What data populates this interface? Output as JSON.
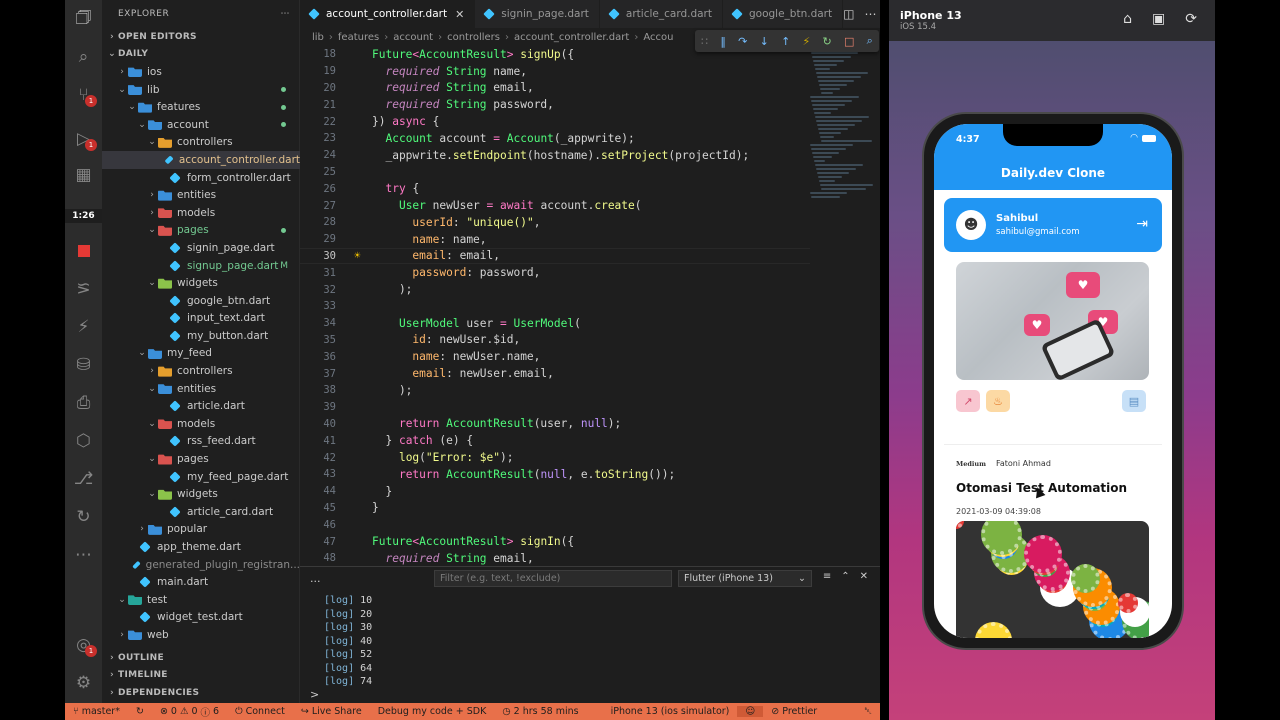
{
  "explorer": {
    "title": "EXPLORER",
    "sections": {
      "open_editors": "OPEN EDITORS",
      "project": "DAILY",
      "outline": "OUTLINE",
      "timeline": "TIMELINE",
      "dependencies": "DEPENDENCIES"
    },
    "tree": [
      {
        "label": "ios",
        "type": "folder",
        "depth": 1,
        "open": false
      },
      {
        "label": "lib",
        "type": "folder",
        "depth": 1,
        "open": true,
        "dot": true
      },
      {
        "label": "features",
        "type": "folder",
        "depth": 2,
        "open": true,
        "dot": true
      },
      {
        "label": "account",
        "type": "folder",
        "depth": 3,
        "open": true,
        "dot": true
      },
      {
        "label": "controllers",
        "type": "folder-orange",
        "depth": 4,
        "open": true
      },
      {
        "label": "account_controller.dart",
        "type": "dart",
        "depth": 5,
        "selected": true,
        "style": "orange"
      },
      {
        "label": "form_controller.dart",
        "type": "dart",
        "depth": 5
      },
      {
        "label": "entities",
        "type": "folder",
        "depth": 4,
        "open": false
      },
      {
        "label": "models",
        "type": "folder-red",
        "depth": 4,
        "open": false
      },
      {
        "label": "pages",
        "type": "folder-red",
        "depth": 4,
        "open": true,
        "style": "green",
        "dot": true
      },
      {
        "label": "signin_page.dart",
        "type": "dart",
        "depth": 5
      },
      {
        "label": "signup_page.dart",
        "type": "dart",
        "depth": 5,
        "style": "green",
        "mark": "M"
      },
      {
        "label": "widgets",
        "type": "folder-green",
        "depth": 4,
        "open": true
      },
      {
        "label": "google_btn.dart",
        "type": "dart",
        "depth": 5
      },
      {
        "label": "input_text.dart",
        "type": "dart",
        "depth": 5
      },
      {
        "label": "my_button.dart",
        "type": "dart",
        "depth": 5
      },
      {
        "label": "my_feed",
        "type": "folder",
        "depth": 3,
        "open": true
      },
      {
        "label": "controllers",
        "type": "folder-orange",
        "depth": 4,
        "open": false
      },
      {
        "label": "entities",
        "type": "folder",
        "depth": 4,
        "open": true
      },
      {
        "label": "article.dart",
        "type": "dart",
        "depth": 5
      },
      {
        "label": "models",
        "type": "folder-red",
        "depth": 4,
        "open": true
      },
      {
        "label": "rss_feed.dart",
        "type": "dart",
        "depth": 5
      },
      {
        "label": "pages",
        "type": "folder-red",
        "depth": 4,
        "open": true
      },
      {
        "label": "my_feed_page.dart",
        "type": "dart",
        "depth": 5
      },
      {
        "label": "widgets",
        "type": "folder-green",
        "depth": 4,
        "open": true
      },
      {
        "label": "article_card.dart",
        "type": "dart",
        "depth": 5
      },
      {
        "label": "popular",
        "type": "folder",
        "depth": 3,
        "open": false
      },
      {
        "label": "app_theme.dart",
        "type": "dart",
        "depth": 2
      },
      {
        "label": "generated_plugin_registran...",
        "type": "dart",
        "depth": 2,
        "style": "muted"
      },
      {
        "label": "main.dart",
        "type": "dart",
        "depth": 2
      },
      {
        "label": "test",
        "type": "folder-teal",
        "depth": 1,
        "open": true
      },
      {
        "label": "widget_test.dart",
        "type": "dart",
        "depth": 2
      },
      {
        "label": "web",
        "type": "folder",
        "depth": 1,
        "open": false
      }
    ]
  },
  "activity": {
    "timer": "1:26",
    "badge_count": "1"
  },
  "tabs": [
    {
      "label": "account_controller.dart",
      "active": true
    },
    {
      "label": "signin_page.dart"
    },
    {
      "label": "article_card.dart"
    },
    {
      "label": "google_btn.dart"
    }
  ],
  "breadcrumb": [
    "lib",
    "features",
    "account",
    "controllers",
    "account_controller.dart",
    "Accou"
  ],
  "editor": {
    "current_line": 30,
    "lines": [
      {
        "n": 18,
        "html": "<span class='ty'>Future</span><span class='pu'>&lt;</span><span class='ty'>AccountResult</span><span class='pu'>&gt;</span> <span class='fn'>signUp</span>({"
      },
      {
        "n": 19,
        "html": "  <span class='k'>required</span> <span class='ty'>String</span> name,"
      },
      {
        "n": 20,
        "html": "  <span class='k'>required</span> <span class='ty'>String</span> email,"
      },
      {
        "n": 21,
        "html": "  <span class='k'>required</span> <span class='ty'>String</span> password,"
      },
      {
        "n": 22,
        "html": "}) <span class='kw'>async</span> {"
      },
      {
        "n": 23,
        "html": "  <span class='ty'>Account</span> account <span class='pu'>=</span> <span class='ty'>Account</span>(_appwrite);"
      },
      {
        "n": 24,
        "html": "  _appwrite.<span class='fn'>setEndpoint</span>(hostname).<span class='fn'>setProject</span>(projectId);"
      },
      {
        "n": 25,
        "html": ""
      },
      {
        "n": 26,
        "html": "  <span class='kw'>try</span> {"
      },
      {
        "n": 27,
        "html": "    <span class='ty'>User</span> newUser <span class='pu'>=</span> <span class='kw'>await</span> account.<span class='fn'>create</span>("
      },
      {
        "n": 28,
        "html": "      <span class='lb'>userId</span>: <span class='st'>\"unique()\"</span>,"
      },
      {
        "n": 29,
        "html": "      <span class='lb'>name</span>: name,"
      },
      {
        "n": 30,
        "html": "      <span class='lb'>email</span>: email,"
      },
      {
        "n": 31,
        "html": "      <span class='lb'>password</span>: password,"
      },
      {
        "n": 32,
        "html": "    );"
      },
      {
        "n": 33,
        "html": ""
      },
      {
        "n": 34,
        "html": "    <span class='ty'>UserModel</span> user <span class='pu'>=</span> <span class='ty'>UserModel</span>("
      },
      {
        "n": 35,
        "html": "      <span class='lb'>id</span>: newUser.$id,"
      },
      {
        "n": 36,
        "html": "      <span class='lb'>name</span>: newUser.name,"
      },
      {
        "n": 37,
        "html": "      <span class='lb'>email</span>: newUser.email,"
      },
      {
        "n": 38,
        "html": "    );"
      },
      {
        "n": 39,
        "html": ""
      },
      {
        "n": 40,
        "html": "    <span class='kw'>return</span> <span class='ty'>AccountResult</span>(user, <span class='nu'>null</span>);"
      },
      {
        "n": 41,
        "html": "  } <span class='kw'>catch</span> (e) {"
      },
      {
        "n": 42,
        "html": "    <span class='fn'>log</span>(<span class='st'>\"Error: $e\"</span>);"
      },
      {
        "n": 43,
        "html": "    <span class='kw'>return</span> <span class='ty'>AccountResult</span>(<span class='nu'>null</span>, e.<span class='fn'>toString</span>());"
      },
      {
        "n": 44,
        "html": "  }"
      },
      {
        "n": 45,
        "html": "}"
      },
      {
        "n": 46,
        "html": ""
      },
      {
        "n": 47,
        "html": "<span class='ty'>Future</span><span class='pu'>&lt;</span><span class='ty'>AccountResult</span><span class='pu'>&gt;</span> <span class='fn'>signIn</span>({"
      },
      {
        "n": 48,
        "html": "  <span class='k'>required</span> <span class='ty'>String</span> email,"
      }
    ]
  },
  "panel": {
    "more": "...",
    "filter_placeholder": "Filter (e.g. text, !exclude)",
    "device": "Flutter (iPhone 13)",
    "prompt": ">",
    "logs": [
      {
        "tag": "[log]",
        "value": "10"
      },
      {
        "tag": "[log]",
        "value": "20"
      },
      {
        "tag": "[log]",
        "value": "30"
      },
      {
        "tag": "[log]",
        "value": "40"
      },
      {
        "tag": "[log]",
        "value": "52"
      },
      {
        "tag": "[log]",
        "value": "64"
      },
      {
        "tag": "[log]",
        "value": "74"
      }
    ]
  },
  "status": {
    "branch": "master*",
    "errors": "0",
    "warnings": "0",
    "infos": "6",
    "connect": "Connect",
    "live_share": "Live Share",
    "debug": "Debug my code + SDK",
    "time": "2 hrs 58 mins",
    "device": "iPhone 13 (ios simulator)",
    "prettier": "Prettier"
  },
  "simulator": {
    "name": "iPhone 13",
    "os": "iOS 15.4",
    "phone_time": "4:37",
    "app_title": "Daily.dev Clone",
    "user": {
      "name": "Sahibul",
      "email": "sahibul@gmail.com"
    },
    "article": {
      "source": "Medium",
      "author": "Fatoni Ahmad",
      "title": "Otomasi Test Automation",
      "date": "2021-03-09 04:39:08"
    }
  },
  "colors": {
    "accent": "#2196f3",
    "statusbar": "#e8704a"
  }
}
